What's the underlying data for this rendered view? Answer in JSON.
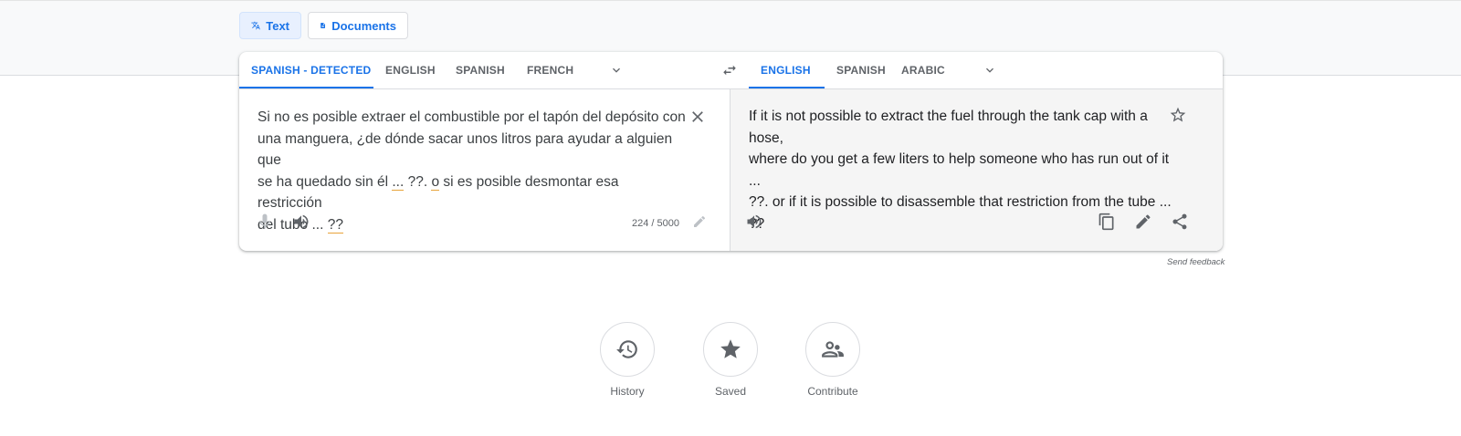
{
  "modes": {
    "text_label": "Text",
    "documents_label": "Documents"
  },
  "source_langs": [
    "SPANISH - DETECTED",
    "ENGLISH",
    "SPANISH",
    "FRENCH"
  ],
  "target_langs": [
    "ENGLISH",
    "SPANISH",
    "ARABIC"
  ],
  "source": {
    "line1": "Si no es posible extraer el combustible por el tapón del depósito con",
    "line2": "una manguera, ¿de dónde sacar unos litros para ayudar a alguien que",
    "line3_a": "se ha quedado sin él ",
    "line3_b": "...",
    "line3_c": " ??. ",
    "line3_d": "o",
    "line3_e": " si es posible desmontar esa restricción",
    "line4_a": "del tubo ... ",
    "line4_b": "??",
    "char_count": "224 / 5000"
  },
  "target": {
    "line1": "If it is not possible to extract the fuel through the tank cap with a hose,",
    "line2": "where do you get a few liters to help someone who has run out of it ...",
    "line3": "??. or if it is possible to disassemble that restriction from the tube ...",
    "line4": "??"
  },
  "feedback_label": "Send feedback",
  "bottom_items": {
    "history": "History",
    "saved": "Saved",
    "contribute": "Contribute"
  },
  "colors": {
    "accent": "#1a73e8",
    "target_bg": "#f5f5f5",
    "squiggle": "#e8a33a"
  }
}
